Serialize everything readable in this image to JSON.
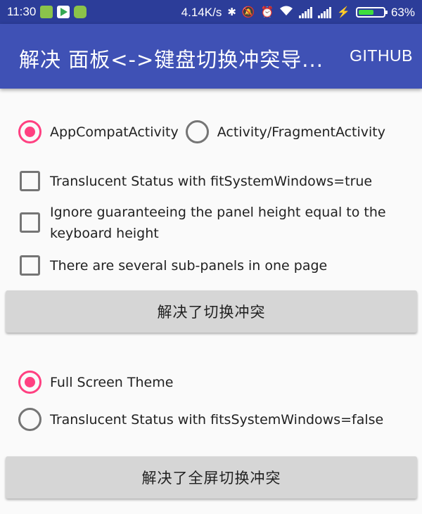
{
  "status_bar": {
    "time": "11:30",
    "network_speed": "4.14K/s",
    "battery_percent": "63%",
    "battery_level": 0.63,
    "app_icons": [
      "battery-app-icon",
      "play-store-icon",
      "android-app-icon"
    ],
    "status_icons": [
      "bluetooth-icon",
      "mute-icon",
      "alarm-icon",
      "wifi-icon",
      "signal-icon",
      "signal-icon",
      "charging-icon"
    ]
  },
  "app_bar": {
    "title": "解决 面板<->键盘切换冲突导...",
    "action_label": "GITHUB"
  },
  "activity_group": {
    "options": [
      {
        "label": "AppCompatActivity",
        "checked": true
      },
      {
        "label": "Activity/FragmentActivity",
        "checked": false
      }
    ]
  },
  "checkboxes": [
    {
      "label": "Translucent Status with fitSystemWindows=true",
      "checked": false
    },
    {
      "label": "Ignore guaranteeing the panel height equal to the keyboard height",
      "checked": false
    },
    {
      "label": "There are several sub-panels in one page",
      "checked": false
    }
  ],
  "resolve_button_label": "解决了切换冲突",
  "theme_group": {
    "options": [
      {
        "label": "Full Screen Theme",
        "checked": true
      },
      {
        "label": "Translucent Status with fitsSystemWindows=false",
        "checked": false
      }
    ]
  },
  "fullscreen_button_label": "解决了全屏切换冲突",
  "colors": {
    "primary": "#3f51b5",
    "primary_dark": "#2c3d99",
    "accent": "#ff4081",
    "button_bg": "#d6d6d6"
  }
}
